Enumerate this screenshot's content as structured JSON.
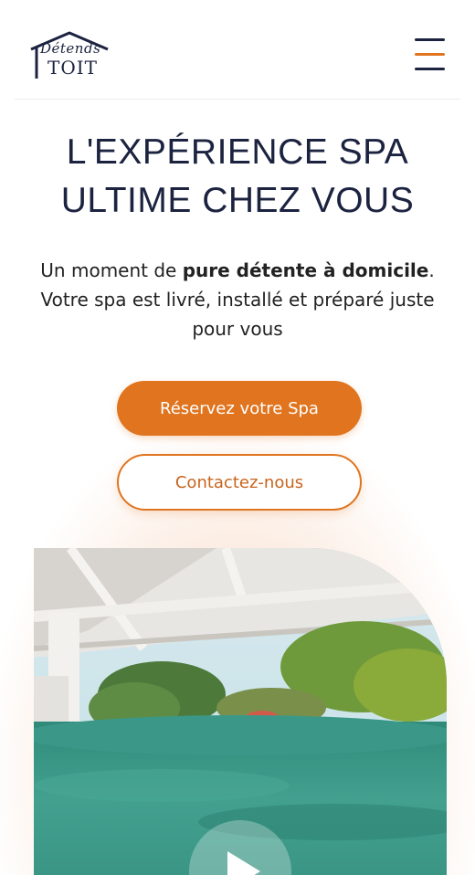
{
  "header": {
    "logo": {
      "script": "Détends",
      "main": "TOIT"
    },
    "menu_icon": "hamburger-menu-icon"
  },
  "hero": {
    "title_line1": "L'EXPÉRIENCE SPA",
    "title_line2": "ULTIME CHEZ VOUS",
    "text_part1": "Un moment de ",
    "text_bold": "pure détente à domicile",
    "text_part2": ". Votre spa est livré, installé et préparé juste pour vous"
  },
  "buttons": {
    "primary_label": "Réservez votre Spa",
    "secondary_label": "Contactez-nous"
  },
  "media": {
    "play_icon": "play-icon"
  },
  "colors": {
    "accent": "#e0741f",
    "navy": "#1c2340",
    "water": "#3f9a8a"
  }
}
